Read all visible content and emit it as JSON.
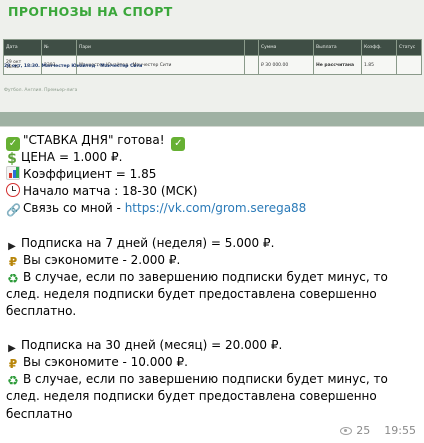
{
  "photo": {
    "title": "ПРОГНОЗЫ НА СПОРТ",
    "table": {
      "headers": [
        "Дата",
        "№",
        "Пари",
        "",
        "Сумма",
        "Выплата",
        "Коэфф.",
        "Статус"
      ],
      "row": [
        "29 окт\n18:45",
        "2393",
        "Манчестер Юнайтед - Манчестер Сити",
        "",
        "₽ 30 000.00",
        "Не рассчитана",
        "1.85",
        ""
      ]
    },
    "note": "29 окт, 18:30. Манчестер Юнайтед - Манчестер Сити",
    "tags": "Футбол. Англия. Премьер-лига"
  },
  "message": {
    "l1": "\"СТАВКА ДНЯ\" готова!",
    "l2": "ЦЕНА = 1.000 ₽.",
    "l3": "Коэффициент = 1.85",
    "l4": "Начало матча : 18-30 (МСК)",
    "l5_prefix": "Связь со мной - ",
    "l5_link": "https://vk.com/grom.serega88",
    "p1": "Подписка на 7 дней (неделя) = 5.000 ₽.",
    "p1_save": "Вы сэкономите - 2.000 ₽.",
    "p1_note_a": "В случае, если по завершению подписки будет минус, то",
    "p1_note_b": "след. неделя подписки будет предоставлена совершенно",
    "p1_note_c": "бесплатно.",
    "p2": "Подписка на 30 дней (месяц) = 20.000 ₽.",
    "p2_save": "Вы сэкономите - 10.000 ₽.",
    "p2_note_a": "В случае, если по завершению подписки будет минус, то",
    "p2_note_b": "след. неделя подписки будет предоставлена совершенно",
    "p2_note_c": "бесплатно"
  },
  "meta": {
    "views": "25",
    "time": "19:55"
  },
  "icons": {
    "check": "check-mark-button-icon",
    "dollar": "heavy-dollar-sign-icon",
    "chart": "bar-chart-icon",
    "clock": "alarm-clock-icon",
    "link": "link-icon",
    "arrow": "play-arrow-icon",
    "bag": "money-bag-icon",
    "recycle": "recycling-icon",
    "eye": "eye-icon"
  },
  "colors": {
    "title_green": "#3aa73a",
    "link_blue": "#2a7ab8",
    "table_header": "#3f4e45"
  }
}
